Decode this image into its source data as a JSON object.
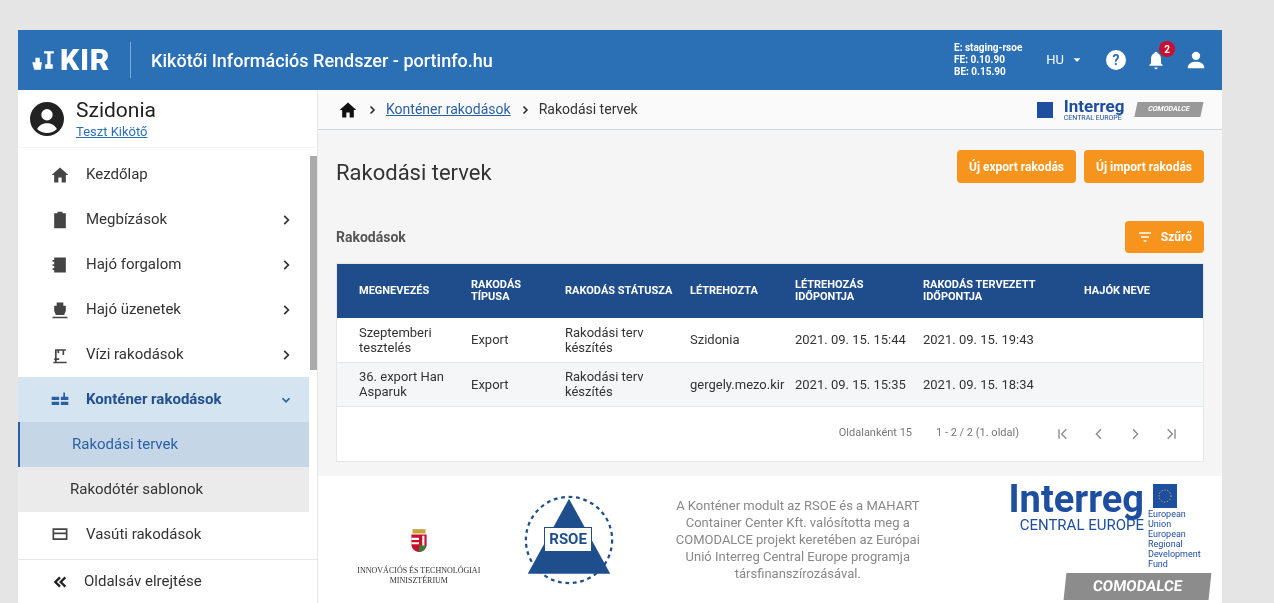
{
  "header": {
    "help": "?",
    "logo": "KIR",
    "title": "Kikötői Információs Rendszer - portinfo.hu",
    "env": [
      "E: staging-rsoe",
      "FE: 0.10.90",
      "BE: 0.15.90"
    ],
    "language": "HU",
    "notifications": "2"
  },
  "user": {
    "name": "Szidonia",
    "port": "Teszt Kikötő"
  },
  "sidebar": {
    "items": [
      {
        "label": "Kezdőlap",
        "kind": "link",
        "selected": false
      },
      {
        "label": "Megbízások",
        "kind": "group",
        "expanded": false,
        "selected": false
      },
      {
        "label": "Hajó forgalom",
        "kind": "group",
        "expanded": false,
        "selected": false
      },
      {
        "label": "Hajó üzenetek",
        "kind": "group",
        "expanded": false,
        "selected": false
      },
      {
        "label": "Vízi rakodások",
        "kind": "group",
        "expanded": false,
        "selected": false
      },
      {
        "label": "Konténer rakodások",
        "kind": "group",
        "expanded": true,
        "selected": true,
        "children": [
          {
            "label": "Rakodási tervek",
            "selected": true
          },
          {
            "label": "Rakodótér sablonok",
            "selected": false
          }
        ]
      },
      {
        "label": "Vasúti rakodások",
        "kind": "link",
        "selected": false
      }
    ],
    "collapse": "Oldalsáv elrejtése"
  },
  "breadcrumb": [
    "Konténer rakodások",
    "Rakodási tervek"
  ],
  "partner_logo": {
    "name": "Interreg",
    "region": "CENTRAL EUROPE",
    "project": "COMODALCE"
  },
  "page": {
    "title": "Rakodási tervek",
    "buttons": [
      "Új export rakodás",
      "Új import rakodás"
    ]
  },
  "section": {
    "title": "Rakodások",
    "filter": "Szűrő"
  },
  "table": {
    "columns": [
      "MEGNEVEZÉS",
      "RAKODÁS TÍPUSA",
      "RAKODÁS STÁTUSZA",
      "LÉTREHOZTA",
      "LÉTREHOZÁS IDŐPONTJA",
      "RAKODÁS TERVEZETT IDŐPONTJA",
      "HAJÓK NEVE"
    ],
    "rows": [
      [
        "Szeptemberi tesztelés",
        "Export",
        "Rakodási terv készítés",
        "Szidonia",
        "2021. 09. 15. 15:44",
        "2021. 09. 15. 19:43"
      ],
      [
        "36. export Han Asparuk",
        "Export",
        "Rakodási terv készítés",
        "gergely.mezo.kir",
        "2021. 09. 15. 15:35",
        "2021. 09. 15. 18:34"
      ]
    ]
  },
  "pagination": {
    "per_page": "Oldalanként 15",
    "range": "1 - 2 / 2 (1. oldal)"
  },
  "footer": {
    "ministry": "INNOVÁCIÓS ÉS TECHNOLÓGIAI MINISZTÉRIUM",
    "rsoe": "RSOE",
    "text": "A Konténer modult az RSOE és a MAHART Container Center Kft. valósította meg a COMODALCE projekt keretében az Európai Unió Interreg Central Europe programja társfinanszírozásával.",
    "interreg": "Interreg",
    "region": "CENTRAL EUROPE",
    "eu": "European Union European Regional Development Fund",
    "project": "COMODALCE"
  }
}
